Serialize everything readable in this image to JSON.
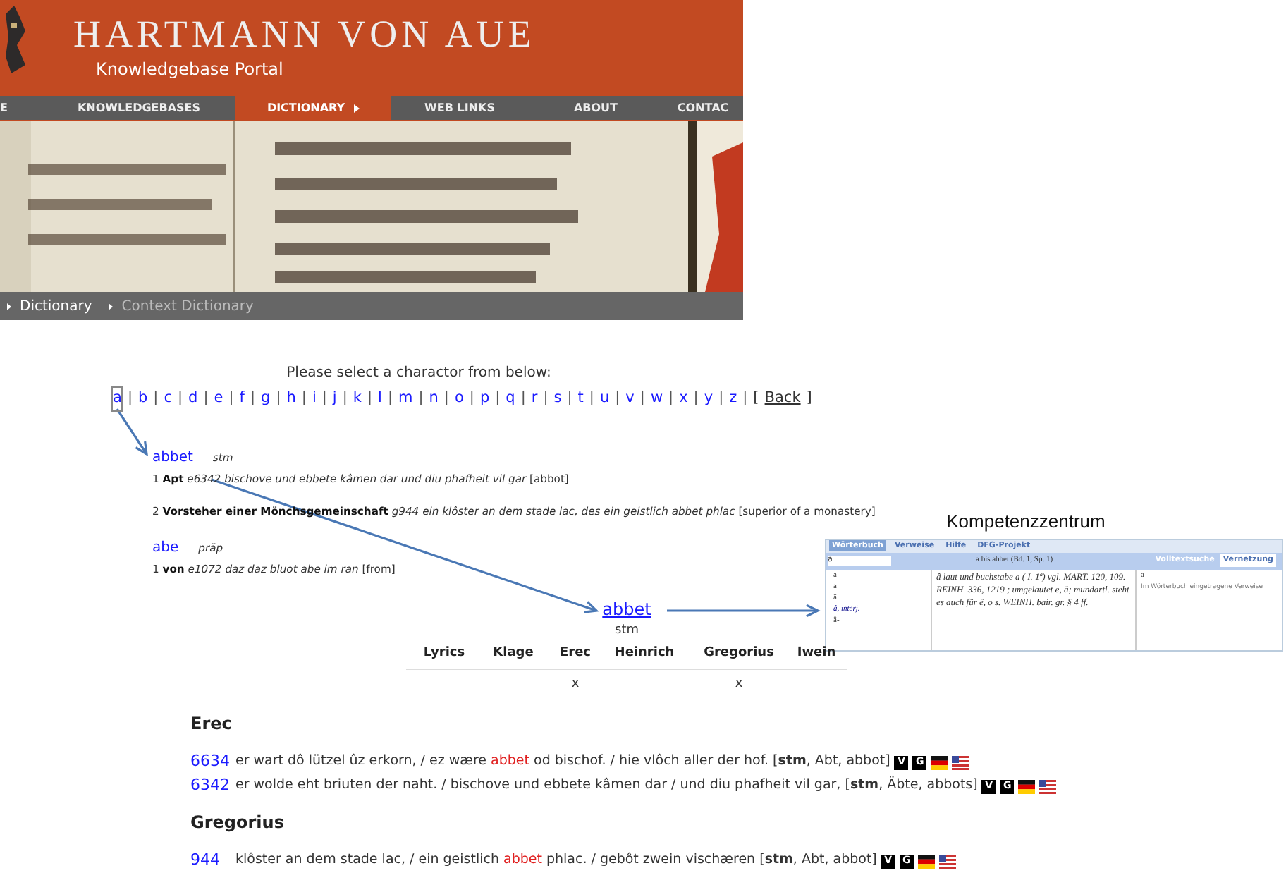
{
  "header": {
    "title": "HARTMANN VON AUE",
    "subtitle": "Knowledgebase Portal"
  },
  "nav": [
    {
      "label": "E",
      "selected": false
    },
    {
      "label": "KNOWLEDGEBASES",
      "selected": false
    },
    {
      "label": "DICTIONARY",
      "selected": true
    },
    {
      "label": "WEB LINKS",
      "selected": false
    },
    {
      "label": "ABOUT",
      "selected": false
    },
    {
      "label": "CONTAC",
      "selected": false
    }
  ],
  "breadcrumb": [
    {
      "label": "Dictionary",
      "current": false
    },
    {
      "label": "Context Dictionary",
      "current": true
    }
  ],
  "selector": {
    "prompt": "Please select a charactor from below:",
    "separator": "|",
    "letters": [
      {
        "label": "a",
        "selected": true
      },
      {
        "label": "b",
        "selected": false
      },
      {
        "label": "c",
        "selected": false
      },
      {
        "label": "d",
        "selected": false
      },
      {
        "label": "e",
        "selected": false
      },
      {
        "label": "f",
        "selected": false
      },
      {
        "label": "g",
        "selected": false
      },
      {
        "label": "h",
        "selected": false
      },
      {
        "label": "i",
        "selected": false
      },
      {
        "label": "j",
        "selected": false
      },
      {
        "label": "k",
        "selected": false
      },
      {
        "label": "l",
        "selected": false
      },
      {
        "label": "m",
        "selected": false
      },
      {
        "label": "n",
        "selected": false
      },
      {
        "label": "o",
        "selected": false
      },
      {
        "label": "p",
        "selected": false
      },
      {
        "label": "q",
        "selected": false
      },
      {
        "label": "r",
        "selected": false
      },
      {
        "label": "s",
        "selected": false
      },
      {
        "label": "t",
        "selected": false
      },
      {
        "label": "u",
        "selected": false
      },
      {
        "label": "v",
        "selected": false
      },
      {
        "label": "w",
        "selected": false
      },
      {
        "label": "x",
        "selected": false
      },
      {
        "label": "y",
        "selected": false
      },
      {
        "label": "z",
        "selected": false
      }
    ],
    "back": {
      "open": "[",
      "label": "Back",
      "close": "]"
    }
  },
  "entries": [
    {
      "lemma": "abbet",
      "pos": "stm",
      "senses": [
        {
          "number": "1",
          "gloss": "Apt",
          "ref": "e6342",
          "quote": "bischove und ebbete kâmen dar und diu phafheit vil gar",
          "translation": "[abbot]"
        },
        {
          "number": "2",
          "gloss": "Vorsteher einer Mönchsgemeinschaft",
          "ref": "g944",
          "quote": "ein klôster an dem stade lac, des ein geistlich abbet phlac",
          "translation": "[superior of a monastery]"
        }
      ]
    },
    {
      "lemma": "abe",
      "pos": "präp",
      "senses": [
        {
          "number": "1",
          "gloss": "von",
          "ref": "e1072",
          "quote": "daz daz bluot abe im ran",
          "translation": "[from]"
        }
      ]
    }
  ],
  "inset": {
    "title": "Kompetenzzentrum",
    "tabs": [
      {
        "label": "Wörterbuch",
        "selected": true
      },
      {
        "label": "Verweise",
        "selected": false
      },
      {
        "label": "Hilfe",
        "selected": false
      },
      {
        "label": "DFG-Projekt",
        "selected": false
      }
    ],
    "search_value": "a",
    "range": "a bis abbet (Bd. 1, Sp. 1)",
    "side_tabs": [
      {
        "label": "Volltextsuche",
        "selected": false
      },
      {
        "label": "Vernetzung",
        "selected": true
      }
    ],
    "list": [
      {
        "label": "a",
        "selected": false
      },
      {
        "label": "a",
        "selected": false
      },
      {
        "label": "â",
        "selected": false
      },
      {
        "label": "â, interj.",
        "selected": true
      },
      {
        "label": "â-",
        "selected": false
      }
    ],
    "article": "â laut und buchstabe a ( I. 1ª) vgl. MART. 120, 109. REINH. 336, 1219 ; umgelautet e, ä; mundartl. steht es auch für ê, o s. WEINH. bair. gr. § 4 ff.",
    "side_word": "a",
    "side_caption": "Im Wörterbuch eingetragene Verweise"
  },
  "headword": {
    "label": "abbet",
    "pos": "stm"
  },
  "works_table": {
    "columns": [
      "Lyrics",
      "Klage",
      "Erec",
      "Heinrich",
      "Gregorius",
      "Iwein"
    ],
    "row": [
      {
        "kind": "blank"
      },
      {
        "kind": "blank"
      },
      {
        "kind": "text",
        "text": "x"
      },
      {
        "kind": "blank"
      },
      {
        "kind": "text",
        "text": "x"
      },
      {
        "kind": "blank"
      }
    ]
  },
  "results": [
    {
      "work": "Erec",
      "lines": [
        {
          "number": "6634",
          "before": "er wart dô lützel ûz erkorn, / ez wære ",
          "hit": "abbet",
          "after": " od bischof. / hie vlôch aller der hof.",
          "gram": "[**stm**, Abt, abbot]",
          "badges": [
            "V",
            "G"
          ]
        },
        {
          "number": "6342",
          "before": "er wolde eht briuten der naht. / bischove und ebbete kâmen dar / und diu phafheit vil gar,",
          "gram": "[**stm**, Äbte, abbots]",
          "badges": [
            "V",
            "G"
          ]
        }
      ]
    },
    {
      "work": "Gregorius",
      "lines": [
        {
          "number": "944",
          "before": "klôster an dem stade lac, / ein geistlich ",
          "hit": "abbet",
          "after": " phlac. / gebôt zwein vischæren",
          "gram": "[**stm**, Abt, abbot]",
          "badges": [
            "V",
            "G"
          ]
        }
      ]
    }
  ]
}
